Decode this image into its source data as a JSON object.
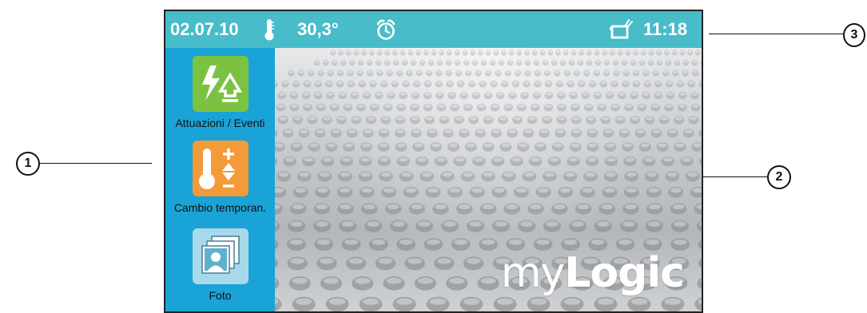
{
  "status_bar": {
    "date": "02.07.10",
    "temperature": "30,3°",
    "time": "11:18",
    "icons": [
      "thermometer-icon",
      "alarm-clock-icon",
      "answering-machine-icon"
    ]
  },
  "sidebar": {
    "apps": [
      {
        "label": "Attuazioni / Eventi",
        "icon": "actuations-events-icon",
        "color": "#7cc242"
      },
      {
        "label": "Cambio temporan.",
        "icon": "temperature-change-icon",
        "color": "#f39a3b"
      },
      {
        "label": "Foto",
        "icon": "photo-icon",
        "color": "#a8d9ea"
      }
    ]
  },
  "wallpaper": {
    "brand_light": "my",
    "brand_bold": "Logic"
  },
  "callouts": {
    "sidebar": "1",
    "wallpaper": "2",
    "status_bar": "3"
  },
  "colors": {
    "status_bar": "#48bcc9",
    "sidebar": "#1aa3d7"
  }
}
